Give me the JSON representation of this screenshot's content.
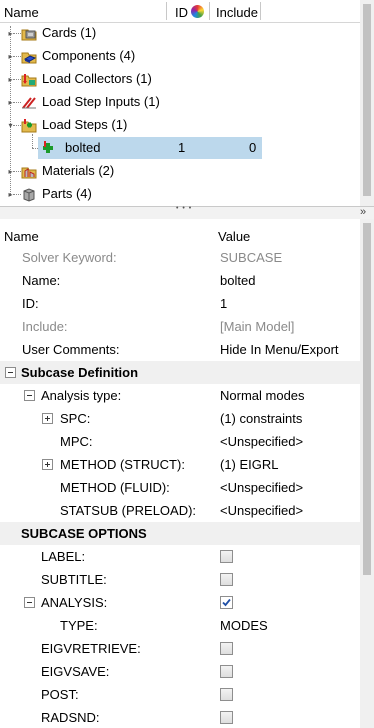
{
  "tree": {
    "columns": {
      "name": "Name",
      "id": "ID",
      "include": "Include"
    },
    "items": [
      {
        "label": "Cards (1)",
        "icon": "cards-icon"
      },
      {
        "label": "Components (4)",
        "icon": "components-icon"
      },
      {
        "label": "Load Collectors (1)",
        "icon": "load-collectors-icon"
      },
      {
        "label": "Load Step Inputs (1)",
        "icon": "load-step-inputs-icon"
      },
      {
        "label": "Load Steps (1)",
        "icon": "load-steps-icon"
      },
      {
        "label": "bolted",
        "id": "1",
        "include": "0",
        "icon": "load-step-icon"
      },
      {
        "label": "Materials (2)",
        "icon": "materials-icon"
      },
      {
        "label": "Parts (4)",
        "icon": "parts-icon"
      }
    ],
    "colors": {
      "selected_row": "#bcd8ec"
    }
  },
  "splitter": {
    "grip": "• • •"
  },
  "props": {
    "columns": {
      "name": "Name",
      "value": "Value"
    },
    "rows": {
      "solver_keyword": {
        "name": "Solver Keyword:",
        "value": "SUBCASE"
      },
      "name": {
        "name": "Name:",
        "value": "bolted"
      },
      "id": {
        "name": "ID:",
        "value": "1"
      },
      "include": {
        "name": "Include:",
        "value": "[Main Model]"
      },
      "user_comments": {
        "name": "User Comments:",
        "value": "Hide In Menu/Export"
      },
      "subcase_definition": {
        "name": "Subcase Definition"
      },
      "analysis_type": {
        "name": "Analysis type:",
        "value": "Normal modes"
      },
      "spc": {
        "name": "SPC:",
        "value": "(1) constraints"
      },
      "mpc": {
        "name": "MPC:",
        "value": "<Unspecified>"
      },
      "method_struct": {
        "name": "METHOD (STRUCT):",
        "value": "(1) EIGRL"
      },
      "method_fluid": {
        "name": "METHOD (FLUID):",
        "value": "<Unspecified>"
      },
      "statsub": {
        "name": "STATSUB (PRELOAD):",
        "value": "<Unspecified>"
      },
      "subcase_options": {
        "name": "SUBCASE OPTIONS"
      },
      "label": {
        "name": "LABEL:",
        "checked": false
      },
      "subtitle": {
        "name": "SUBTITLE:",
        "checked": false
      },
      "analysis": {
        "name": "ANALYSIS:",
        "checked": true
      },
      "type": {
        "name": "TYPE:",
        "value": "MODES"
      },
      "eigvretrieve": {
        "name": "EIGVRETRIEVE:",
        "checked": false
      },
      "eigvsave": {
        "name": "EIGVSAVE:",
        "checked": false
      },
      "post": {
        "name": "POST:",
        "checked": false
      },
      "radsnd": {
        "name": "RADSND:",
        "checked": false
      }
    }
  }
}
